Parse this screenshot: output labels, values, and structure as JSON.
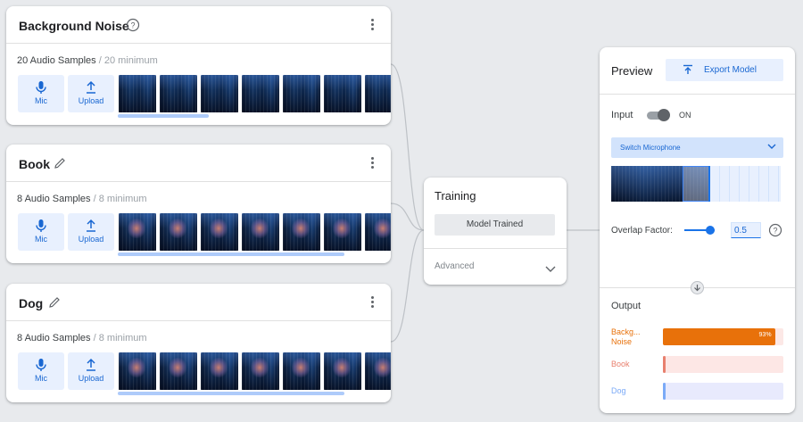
{
  "classes": [
    {
      "name": "Background Noise",
      "count": "20 Audio Samples",
      "minimum": " / 20 minimum",
      "icon": "help-circle-icon"
    },
    {
      "name": "Book",
      "count": "8 Audio Samples",
      "minimum": " / 8 minimum",
      "icon": "pencil-icon"
    },
    {
      "name": "Dog",
      "count": "8 Audio Samples",
      "minimum": " / 8 minimum",
      "icon": "pencil-icon"
    }
  ],
  "buttons": {
    "mic": "Mic",
    "upload": "Upload"
  },
  "training": {
    "title": "Training",
    "status": "Model Trained",
    "advanced": "Advanced"
  },
  "preview": {
    "title": "Preview",
    "export_label": "Export Model",
    "input_label": "Input",
    "toggle_state": "ON",
    "microphone_select": "Switch Microphone",
    "overlap_label": "Overlap Factor:",
    "overlap_value": "0.5",
    "output_label": "Output",
    "outputs": [
      {
        "name": "Backg… Noise",
        "name_line1": "Backg...",
        "name_line2": "Noise",
        "value": 0.93,
        "pct_label": "93%",
        "color": "#e8710a",
        "track": "#fce8e6"
      },
      {
        "name": "Book",
        "value": 0.02,
        "color": "#e8806e",
        "track": "#fde7e5"
      },
      {
        "name": "Dog",
        "value": 0.02,
        "color": "#7baaf7",
        "track": "#e8eafd"
      }
    ]
  },
  "colors": {
    "accent": "#1967d2",
    "accent_light": "#e8f0fe",
    "background": "#e8eaed",
    "orange": "#e8710a"
  }
}
